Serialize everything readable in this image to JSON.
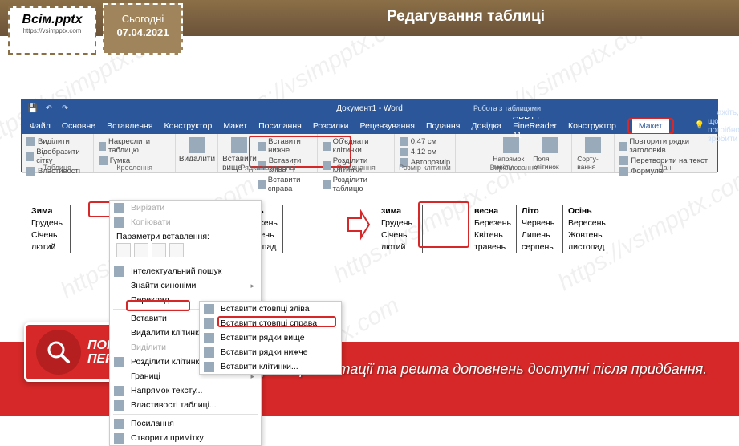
{
  "header": {
    "logo_main": "Всім.pptx",
    "logo_sub": "https://vsimpptx.com",
    "date_label": "Сьогодні",
    "date_value": "07.04.2021",
    "title": "Редагування таблиці"
  },
  "word": {
    "doc_title": "Документ1 - Word",
    "context_group": "Робота з таблицями",
    "tabs": [
      "Файл",
      "Основне",
      "Вставлення",
      "Конструктор",
      "Макет",
      "Посилання",
      "Розсилки",
      "Рецензування",
      "Подання",
      "Довідка",
      "ABBYY FineReader 11",
      "Конструктор",
      "Макет"
    ],
    "tell_me": "Скажіть, що потрібно зробити",
    "ribbon": {
      "g1": {
        "label": "Таблиця",
        "items": [
          "Виділити",
          "Відобразити сітку",
          "Властивості"
        ]
      },
      "g2": {
        "label": "Креслення",
        "items": [
          "Накреслити таблицю",
          "Гумка"
        ]
      },
      "g3": {
        "label": "",
        "btn": "Видалити"
      },
      "g4": {
        "label": "Рядки та стовпці",
        "btn": "Вставити вище",
        "items": [
          "Вставити нижче",
          "Вставити зліва",
          "Вставити справа"
        ]
      },
      "g5": {
        "label": "Об'єднання",
        "items": [
          "Об'єднати клітинки",
          "Розділити клітинки",
          "Розділити таблицю"
        ]
      },
      "g6": {
        "label": "Розмір клітинки",
        "h": "0,47 см",
        "w": "4,12 см",
        "auto": "Авторозмір"
      },
      "g7": {
        "label": "Вирівнювання",
        "a": "Напрямок тексту",
        "b": "Поля клітинок"
      },
      "g8": {
        "label": "",
        "btn": "Сорту-вання"
      },
      "g9": {
        "label": "Дані",
        "items": [
          "Повторити рядки заголовків",
          "Перетворити на текст",
          "Формула"
        ]
      }
    }
  },
  "table_left": {
    "headers": [
      "Зима"
    ],
    "rows": [
      "Грудень",
      "Січень",
      "лютий"
    ]
  },
  "table_hidden": {
    "headers": [
      "сень",
      "Осінь"
    ],
    "rows": [
      [
        "сень",
        "Вересень"
      ],
      [
        "тень",
        "Жовтень"
      ],
      [
        "сень",
        "листопад"
      ]
    ]
  },
  "table_right": {
    "headers": [
      "зима",
      "",
      "весна",
      "Літо",
      "Осінь"
    ],
    "rows": [
      [
        "Грудень",
        "",
        "Березень",
        "Червень",
        "Вересень"
      ],
      [
        "Січень",
        "",
        "Квітень",
        "Липень",
        "Жовтень"
      ],
      [
        "лютий",
        "",
        "травень",
        "серпень",
        "листопад"
      ]
    ]
  },
  "ctx": {
    "cut": "Вирізати",
    "copy": "Копіювати",
    "paste_opts": "Параметри вставлення:",
    "smart": "Інтелектуальний пошук",
    "syn": "Знайти синоніми",
    "trans": "Переклад",
    "insert": "Вставити",
    "del": "Видалити клітинки...",
    "sel": "Виділити",
    "split": "Розділити клітинки...",
    "borders": "Границі",
    "dir": "Напрямок тексту...",
    "props": "Властивості таблиці...",
    "link": "Посилання",
    "comment": "Створити примітку"
  },
  "sub": {
    "cols_left": "Вставити стовпці зліва",
    "cols_right": "Вставити стовпці справа",
    "rows_above": "Вставити рядки вище",
    "rows_below": "Вставити рядки нижче",
    "cells": "Вставити клітинки..."
  },
  "footer": {
    "btn_line1": "ПОПЕРЕДНІЙ",
    "btn_line2": "ПЕРЕГЛЯД",
    "text": "Повна версія презентації та решта доповнень доступні після придбання."
  },
  "watermark": "https://vsimpptx.com"
}
